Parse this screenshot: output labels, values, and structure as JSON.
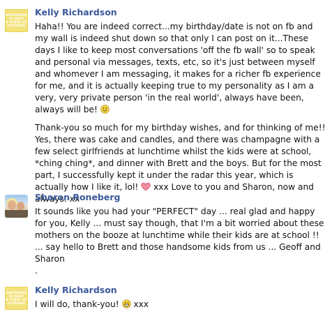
{
  "comments": [
    {
      "author": "Kelly Richardson",
      "avatar": {
        "type": "logo",
        "lines": [
          "Happiness",
          "is only",
          "a state of",
          "courage"
        ]
      },
      "p1": "Haha!! You are indeed correct...my birthday/date is not on fb and my wall is indeed shut down so that only I can post on it...These days I like to keep most conversations 'off the fb wall' so to speak and personal via messages, texts, etc, so it's just between myself and whomever I am messaging, it makes for a richer fb experience for me, and it is actually keeping true to my personality as I am a very, very private person 'in the real world', always have been, always will be!",
      "p2": "Thank-you so much for my birthday wishes, and for thinking of me!! Yes, there was cake and candles, and there was champagne with a few select girlfriends at lunchtime whilst the kids were at school, *ching ching*, and dinner with Brett and the boys. But for the most part, I successfully kept it under the radar this year, which is actually how I like it, lol!",
      "p2_tail": " xxx Love to you and Sharon, now and always. xx"
    },
    {
      "author": "Sharon Roneberg",
      "avatar": {
        "type": "photo"
      },
      "text": "It sounds like you had your \"PERFECT\" day ... real glad and happy for you, Kelly ... must say though, that I'm a bit worried about these mothers on the booze at lunchtime while their kids are at school !! ... say hello to Brett and those handsome kids from us ... Geoff and Sharon",
      "trailing": "."
    },
    {
      "author": "Kelly Richardson",
      "avatar": {
        "type": "logo",
        "lines": [
          "Happiness",
          "is only",
          "a state of",
          "courage"
        ]
      },
      "text": "I will do, thank-you!",
      "tail": " xxx"
    }
  ],
  "icons": {
    "smile": "smile-emoticon-icon",
    "heart": "heart-emoticon-icon",
    "grin": "grin-emoticon-icon"
  },
  "colors": {
    "author_link": "#3b5998",
    "logo_bg": "#f3e27a",
    "heart": "#e8546f",
    "emoticon": "#f4d544"
  }
}
